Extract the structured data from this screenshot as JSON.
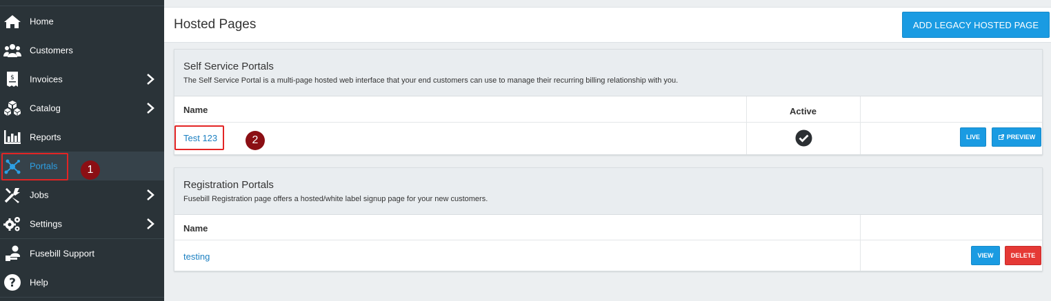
{
  "sidebar": {
    "items": [
      {
        "label": "Home",
        "icon": "home-icon"
      },
      {
        "label": "Customers",
        "icon": "users-icon"
      },
      {
        "label": "Invoices",
        "icon": "invoice-icon"
      },
      {
        "label": "Catalog",
        "icon": "cubes-icon"
      },
      {
        "label": "Reports",
        "icon": "bar-chart-icon"
      },
      {
        "label": "Portals",
        "icon": "network-icon"
      },
      {
        "label": "Jobs",
        "icon": "tools-icon"
      },
      {
        "label": "Settings",
        "icon": "gears-icon"
      },
      {
        "label": "Fusebill Support",
        "icon": "support-icon"
      },
      {
        "label": "Help",
        "icon": "help-icon"
      }
    ]
  },
  "annotations": {
    "step1": "1",
    "step2": "2"
  },
  "header": {
    "title": "Hosted Pages",
    "add_button": "ADD LEGACY HOSTED PAGE"
  },
  "self_service": {
    "title": "Self Service Portals",
    "description": "The Self Service Portal is a multi-page hosted web interface that your end customers can use to manage their recurring billing relationship with you.",
    "columns": {
      "name": "Name",
      "active": "Active"
    },
    "rows": [
      {
        "name": "Test 123",
        "active": true,
        "live_label": "LIVE",
        "preview_label": "PREVIEW"
      }
    ]
  },
  "registration": {
    "title": "Registration Portals",
    "description": "Fusebill Registration page offers a hosted/white label signup page for your new customers.",
    "columns": {
      "name": "Name"
    },
    "rows": [
      {
        "name": "testing",
        "view_label": "VIEW",
        "delete_label": "DELETE"
      }
    ]
  },
  "colors": {
    "sidebar": "#2a3338",
    "accent": "#1a9be2",
    "danger": "#e53935",
    "link": "#1a7fc1"
  }
}
